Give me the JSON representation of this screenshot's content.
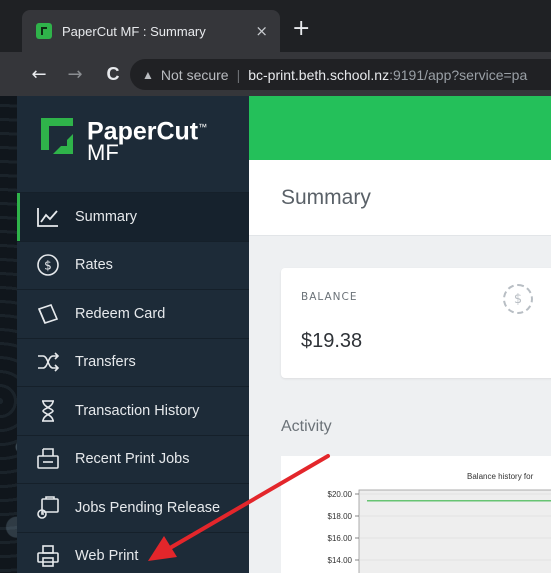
{
  "browser": {
    "tab_title": "PaperCut MF : Summary",
    "tab_close": "×",
    "new_tab": "+",
    "back": "←",
    "forward": "→",
    "reload": "C",
    "security_warning": "Not secure",
    "url_host": "bc-print.beth.school.nz",
    "url_rest": ":9191/app?service=pa"
  },
  "logo": {
    "line1": "PaperCut",
    "line2": "MF",
    "trademark": "™"
  },
  "sidebar": {
    "items": [
      {
        "label": "Summary",
        "icon": "summary-chart-icon",
        "active": true
      },
      {
        "label": "Rates",
        "icon": "dollar-circle-icon"
      },
      {
        "label": "Redeem Card",
        "icon": "card-icon"
      },
      {
        "label": "Transfers",
        "icon": "transfer-arrows-icon"
      },
      {
        "label": "Transaction History",
        "icon": "hourglass-icon"
      },
      {
        "label": "Recent Print Jobs",
        "icon": "printer-tray-icon"
      },
      {
        "label": "Jobs Pending Release",
        "icon": "pending-release-icon"
      },
      {
        "label": "Web Print",
        "icon": "printer-icon"
      }
    ]
  },
  "main": {
    "page_title": "Summary",
    "balance_label": "BALANCE",
    "balance_value": "$19.38",
    "activity_label": "Activity"
  },
  "chart_data": {
    "type": "line",
    "title": "Balance history for",
    "y_ticks": [
      "$20.00",
      "$18.00",
      "$16.00",
      "$14.00"
    ],
    "ylim": [
      14,
      20
    ],
    "series": [
      {
        "values": [
          19.38,
          19.38,
          19.38,
          19.38,
          19.38,
          19.38,
          19.38,
          19.38,
          19.38,
          19.38
        ]
      }
    ],
    "line_color": "#3ab54a"
  },
  "colors": {
    "brand_green": "#24c05a",
    "sidebar_bg": "#1d2b38",
    "annotation_arrow": "#e3262b"
  }
}
